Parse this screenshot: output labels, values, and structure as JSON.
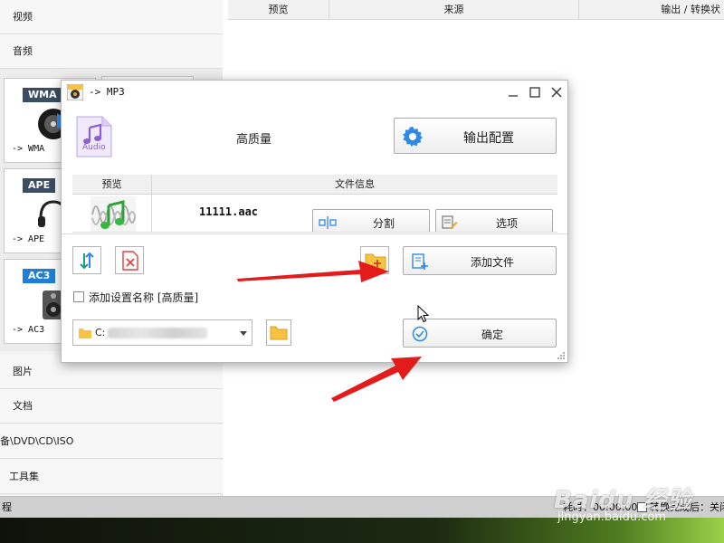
{
  "app": {
    "categories": {
      "video": "视频",
      "audio": "音频",
      "picture": "图片",
      "document": "文档",
      "disc": "备\\DVD\\CD\\ISO",
      "tools": "工具集"
    },
    "formats": [
      {
        "tag": "WMA",
        "label": "-> WMA"
      },
      {
        "tag": "APE",
        "label": "-> APE"
      },
      {
        "tag": "AC3",
        "label": "-> AC3"
      }
    ],
    "list_columns": {
      "preview": "预览",
      "source": "来源",
      "output": "输出 / 转换状"
    },
    "status": {
      "left": "程",
      "time": "耗时：00:00:00",
      "after": "转换完成后：关闭"
    }
  },
  "dialog": {
    "title": "-> MP3",
    "audio_icon_text": "Audio",
    "quality": "高质量",
    "output_config_label": "输出配置",
    "table": {
      "col_preview": "预览",
      "col_fileinfo": "文件信息",
      "row": {
        "filename": "11111.aac",
        "split_label": "分割",
        "options_label": "选项"
      }
    },
    "add_file_label": "添加文件",
    "add_setting_name_label": "添加设置名称 [高质量]",
    "path_prefix": "C:",
    "confirm_label": "确定"
  },
  "watermark": {
    "main": "Baidu 经验",
    "sub": "jingyan.baidu.com"
  },
  "colors": {
    "accent_blue": "#2f89e6",
    "arrow_red": "#e41b1b",
    "folder_yellow": "#f6c342",
    "audio_purple": "#8e5fd0"
  }
}
